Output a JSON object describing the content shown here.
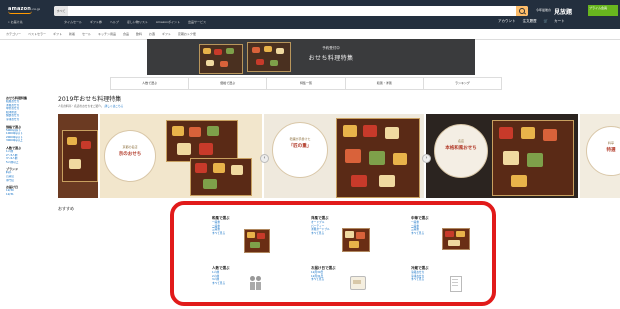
{
  "header": {
    "logo": "amazon",
    "logo_sub": ".co.jp",
    "search_category": "すべて",
    "search_placeholder": "",
    "promo_line1": "今年最後の",
    "promo_big": "見放題",
    "promo_green": "プライム会員",
    "deliver_to": "お届け先",
    "subnav": [
      "タイムセール",
      "ギフト券",
      "ヘルプ",
      "ほしい物リスト",
      "Amazonポイント",
      "出品サービス"
    ],
    "account": [
      "アカウント",
      "注文履歴",
      "カート"
    ]
  },
  "nav2": [
    "カテゴリー",
    "ベストセラー",
    "ギフト",
    "新着",
    "セール",
    "キッチン用品",
    "食品",
    "飲料",
    "お酒",
    "ギフト",
    "定期おトク便"
  ],
  "banner": {
    "small": "予約受付中",
    "title": "おせち料理特集"
  },
  "tabs": [
    "人数で選ぶ",
    "価格で選ぶ",
    "特集一覧",
    "和風・洋風",
    "ランキング"
  ],
  "sidebar": {
    "sections": [
      {
        "heading": "おせち料理特集",
        "links": [
          "和風おせち",
          "洋風おせち",
          "中華おせち",
          "和洋折衷",
          "個食おせち",
          "冷凍おせち"
        ]
      },
      {
        "heading": "価格で選ぶ",
        "links": [
          "5000円以下",
          "10000円以下",
          "20000円以下",
          "30000円以上"
        ]
      },
      {
        "heading": "人数で選ぶ",
        "links": [
          "1人前",
          "2〜3人前",
          "3〜4人前",
          "5人前以上"
        ]
      },
      {
        "heading": "ブランド",
        "links": [
          "料亭",
          "百貨店",
          "専門店"
        ]
      },
      {
        "heading": "お届け日",
        "links": [
          "12/30",
          "12/31"
        ]
      }
    ]
  },
  "main": {
    "heading": "2019年おせち料理特集",
    "desc_text": "人気の料亭・名店のおせちをご紹介。",
    "desc_link": "詳しくはこちら"
  },
  "carousel": {
    "slides": [
      {
        "ring_small": "京都の名店",
        "ring_big": "京のおせち"
      },
      {
        "ring_small": "老舗が手掛けた",
        "ring_big": "「匠の重」"
      },
      {
        "ring_small": "名店",
        "ring_big": "本格和風おせち"
      },
      {
        "ring_small": "料亭",
        "ring_big": "特選"
      }
    ],
    "prev": "‹",
    "next": "›"
  },
  "bottom": {
    "title": "おすすめ",
    "categories": [
      {
        "title": "和風で選ぶ",
        "links": [
          "一段重",
          "二段重",
          "三段重",
          "すべて見る"
        ]
      },
      {
        "title": "洋風で選ぶ",
        "links": [
          "オードブル",
          "パーティー",
          "洋風オードブル",
          "すべて見る"
        ]
      },
      {
        "title": "中華で選ぶ",
        "links": [
          "一段重",
          "二段重",
          "三段重",
          "すべて見る"
        ]
      },
      {
        "title": "人数で選ぶ",
        "links": [
          "1人前",
          "2人前",
          "3人前",
          "すべて見る"
        ]
      },
      {
        "title": "お届け日で選ぶ",
        "links": [
          "12月30日",
          "12月31日",
          "すべて見る"
        ]
      },
      {
        "title": "冷蔵で選ぶ",
        "links": [
          "冷蔵おせち",
          "冷凍おせち",
          "すべて見る"
        ]
      }
    ]
  }
}
